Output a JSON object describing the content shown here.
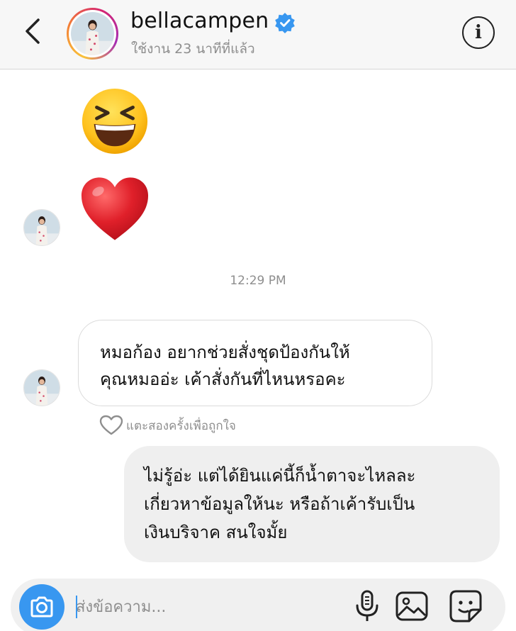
{
  "header": {
    "username": "bellacampen",
    "activity": "ใช้งาน 23 นาทีที่แล้ว",
    "back_icon": "chevron-left-icon",
    "info_label": "i",
    "verified_icon": "verified-badge-icon"
  },
  "messages": [
    {
      "type": "emoji",
      "emoji": "😆",
      "from": "bellacampen"
    },
    {
      "type": "emoji",
      "emoji": "❤️",
      "from": "bellacampen"
    }
  ],
  "timestamp": "12:29 PM",
  "incoming": {
    "line1": "หมอก้อง อยากช่วยสั่งชุดป้องกันให้",
    "line2": "คุณหมออ่ะ เค้าสั่งกันที่ไหนหรอคะ"
  },
  "like_hint": "แตะสองครั้งเพื่อถูกใจ",
  "outgoing": {
    "line1": "ไม่รู้อ่ะ แต่ได้ยินแค่นี้ก็น้ำตาจะไหลละ",
    "line2": "เกี่ยวหาข้อมูลให้นะ หรือถ้าเค้ารับเป็น",
    "line3": "เงินบริจาค สนใจมั้ย"
  },
  "composer": {
    "placeholder": "ส่งข้อความ...",
    "camera_icon": "camera-icon",
    "mic_icon": "microphone-icon",
    "gallery_icon": "image-gallery-icon",
    "sticker_icon": "sticker-icon"
  },
  "colors": {
    "accent": "#3897f0",
    "verified": "#3897f0",
    "heart": "#e0202a",
    "header_bg": "#f7f7f7",
    "outgoing_bg": "#efefef"
  }
}
